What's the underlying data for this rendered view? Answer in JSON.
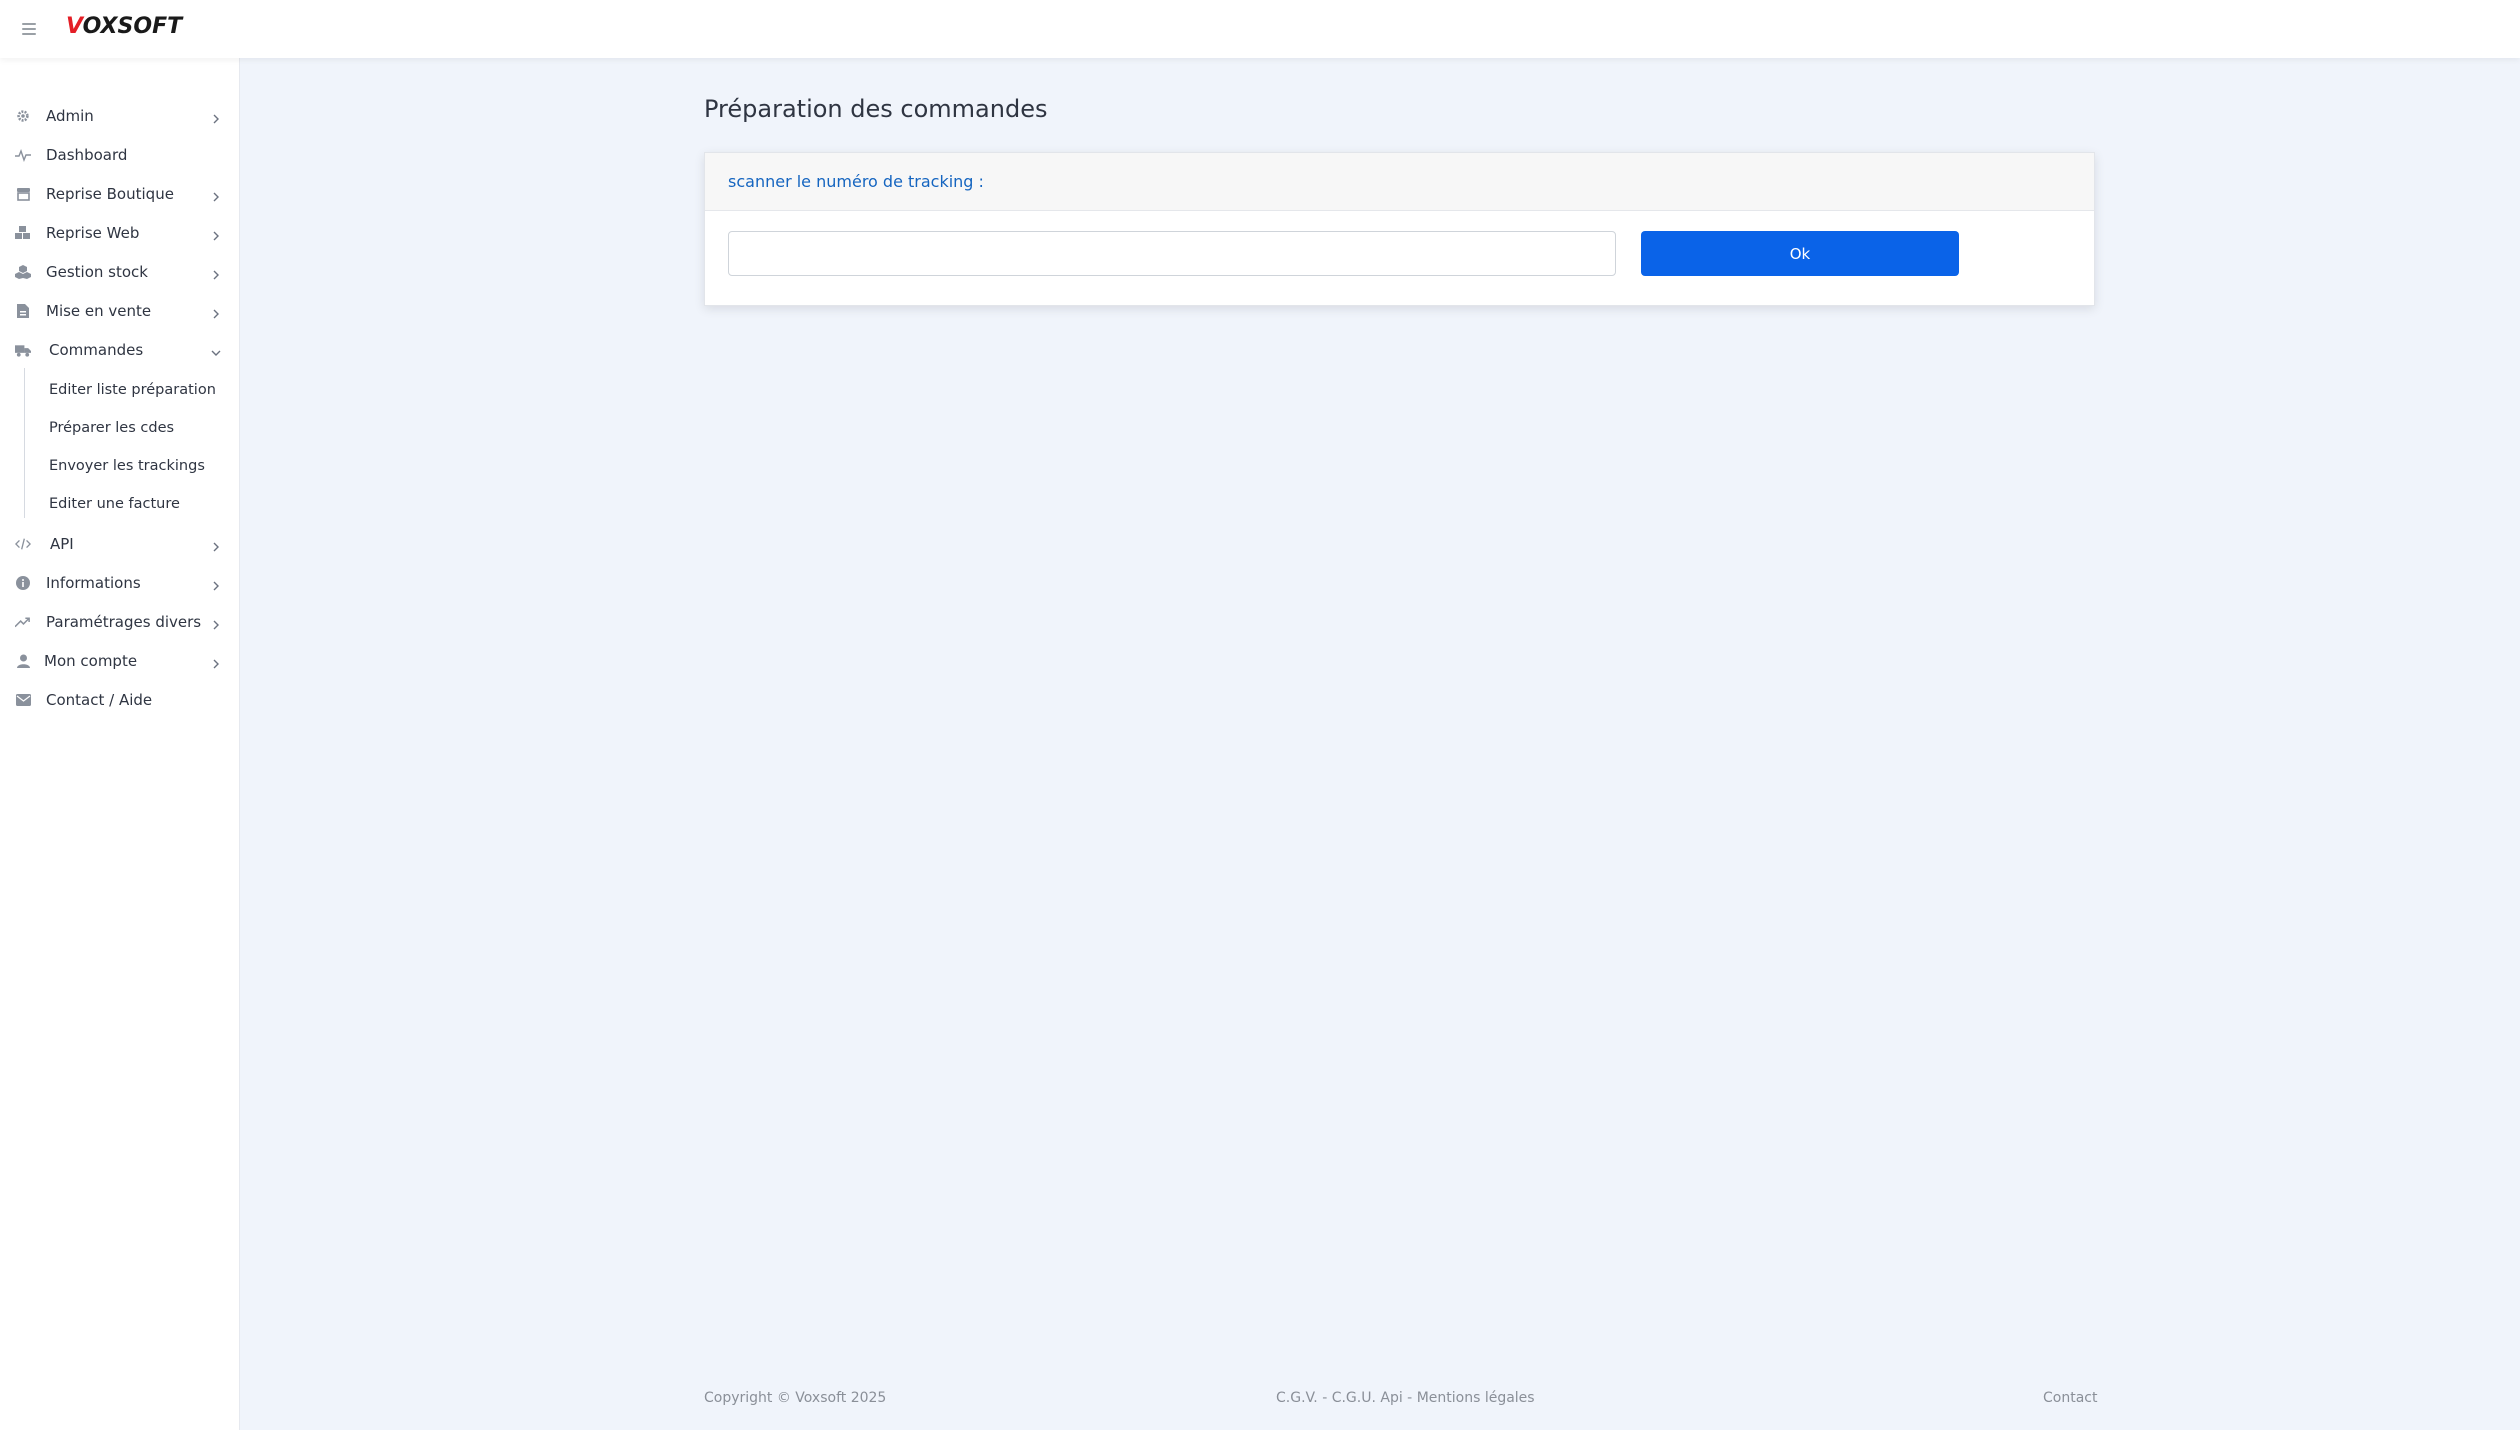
{
  "brand": {
    "logo_v": "V",
    "logo_rest": "OXSOFT"
  },
  "sidebar": {
    "items": [
      {
        "label": "Admin",
        "icon": "gear-icon",
        "has_chevron": true
      },
      {
        "label": "Dashboard",
        "icon": "pulse-icon",
        "has_chevron": false
      },
      {
        "label": "Reprise Boutique",
        "icon": "store-icon",
        "has_chevron": true
      },
      {
        "label": "Reprise Web",
        "icon": "boxes-icon",
        "has_chevron": true
      },
      {
        "label": "Gestion stock",
        "icon": "cubes-icon",
        "has_chevron": true
      },
      {
        "label": "Mise en vente",
        "icon": "file-icon",
        "has_chevron": true
      },
      {
        "label": "Commandes",
        "icon": "truck-icon",
        "has_chevron": true,
        "expanded": true
      },
      {
        "label": "API",
        "icon": "code-icon",
        "has_chevron": true
      },
      {
        "label": "Informations",
        "icon": "info-icon",
        "has_chevron": true
      },
      {
        "label": "Paramétrages divers",
        "icon": "trending-icon",
        "has_chevron": true
      },
      {
        "label": "Mon compte",
        "icon": "user-icon",
        "has_chevron": true
      },
      {
        "label": "Contact / Aide",
        "icon": "envelope-icon",
        "has_chevron": false
      }
    ],
    "commandes_sub": [
      "Editer liste préparation",
      "Préparer les cdes",
      "Envoyer les trackings",
      "Editer une facture"
    ]
  },
  "main": {
    "title": "Préparation des commandes",
    "card": {
      "header": "scanner le numéro de tracking :",
      "input_value": "",
      "button_label": "Ok"
    }
  },
  "footer": {
    "copyright": "Copyright © Voxsoft 2025",
    "cgv": "C.G.V.",
    "sep1": " - ",
    "cgu": "C.G.U. Api",
    "sep2": " - ",
    "mentions": "Mentions légales",
    "contact": "Contact"
  },
  "colors": {
    "accent": "#0a63e8",
    "header_text": "#1565c0",
    "logo_red": "#e41e26",
    "background": "#f0f4fb"
  }
}
